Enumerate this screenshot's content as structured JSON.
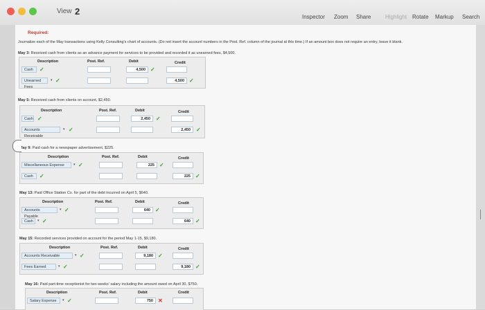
{
  "window": {
    "view_label": "View",
    "page_number": "2",
    "tools": [
      "Inspector",
      "Zoom",
      "Share",
      "Highlight",
      "Rotate",
      "Markup",
      "Search"
    ]
  },
  "instructions": {
    "heading": "Required:",
    "line": "Journalize each of the May transactions using Kelly Consulting's chart of accounts. (Do not insert the account numbers in the Post. Ref. column of the journal at this time.) If an amount box does not require an entry, leave it blank."
  },
  "columns": {
    "description": "Description",
    "post_ref": "Post. Ref.",
    "debit": "Debit",
    "credit": "Credit"
  },
  "entries": [
    {
      "title_bold": "May 3:",
      "title_rest": "Received cash from clients as an advance payment for services to be provided and recorded it as unearned fees, $4,500.",
      "debit_account": "Cash",
      "credit_account": "Unearned Fees",
      "debit_amount": "4,500",
      "credit_amount": "4,500"
    },
    {
      "title_bold": "May 5:",
      "title_rest": "Received cash from clients on account, $2,450.",
      "debit_account": "Cash",
      "credit_account": "Accounts Receivable",
      "debit_amount": "2,450",
      "credit_amount": "2,450"
    },
    {
      "title_bold": "May 9:",
      "title_rest": "Paid cash for a newspaper advertisement, $225.",
      "debit_account": "Miscellaneous Expense",
      "credit_account": "Cash",
      "debit_amount": "225",
      "credit_amount": "225"
    },
    {
      "title_bold": "May 13:",
      "title_rest": "Paid Office Station Co. for part of the debt incurred on April 5, $640.",
      "debit_account": "Accounts Payable",
      "credit_account": "Cash",
      "debit_amount": "640",
      "credit_amount": "640"
    },
    {
      "title_bold": "May 15:",
      "title_rest": "Recorded services provided on account for the period May 1-15, $9,180.",
      "debit_account": "Accounts Receivable",
      "credit_account": "Fees Earned",
      "debit_amount": "9,180",
      "credit_amount": "9,180"
    },
    {
      "title_bold": "May 16:",
      "title_rest": "Paid part-time receptionist for two weeks' salary including the amount owed on April 30, $750.",
      "debit_account": "Salary Expense",
      "credit_account": "",
      "debit_amount": "750",
      "credit_amount": ""
    }
  ],
  "colors": {
    "check": "#3aa22a",
    "error": "#d0312d",
    "field_border": "#b7c9d8"
  }
}
